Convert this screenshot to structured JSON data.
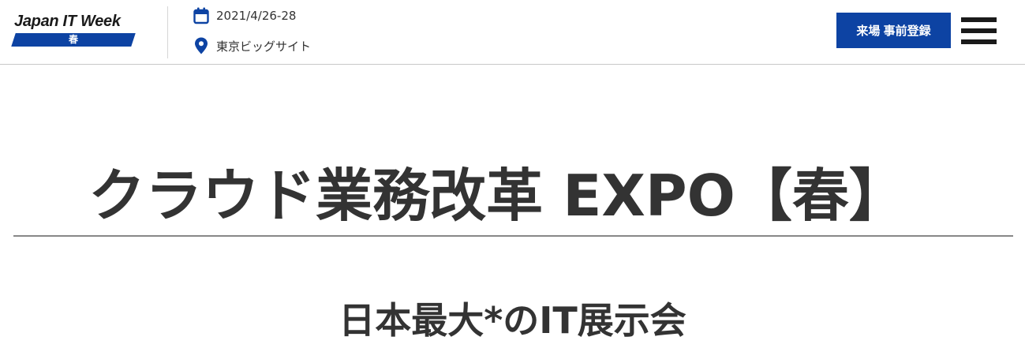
{
  "header": {
    "logo": {
      "name": "Japan IT Week",
      "season": "春",
      "band_color": "#0d43a3"
    },
    "date": {
      "icon": "calendar-icon",
      "text": "2021/4/26-28"
    },
    "venue": {
      "icon": "map-pin-icon",
      "text": "東京ビッグサイト"
    },
    "register_button": {
      "label": "来場 事前登録",
      "color": "#0d43a3"
    },
    "menu": {
      "icon": "hamburger-menu-icon"
    }
  },
  "main": {
    "title": "クラウド業務改革 EXPO【春】",
    "subtitle": "日本最大*のIT展示会"
  },
  "colors": {
    "accent": "#0d43a3",
    "text": "#333333"
  }
}
